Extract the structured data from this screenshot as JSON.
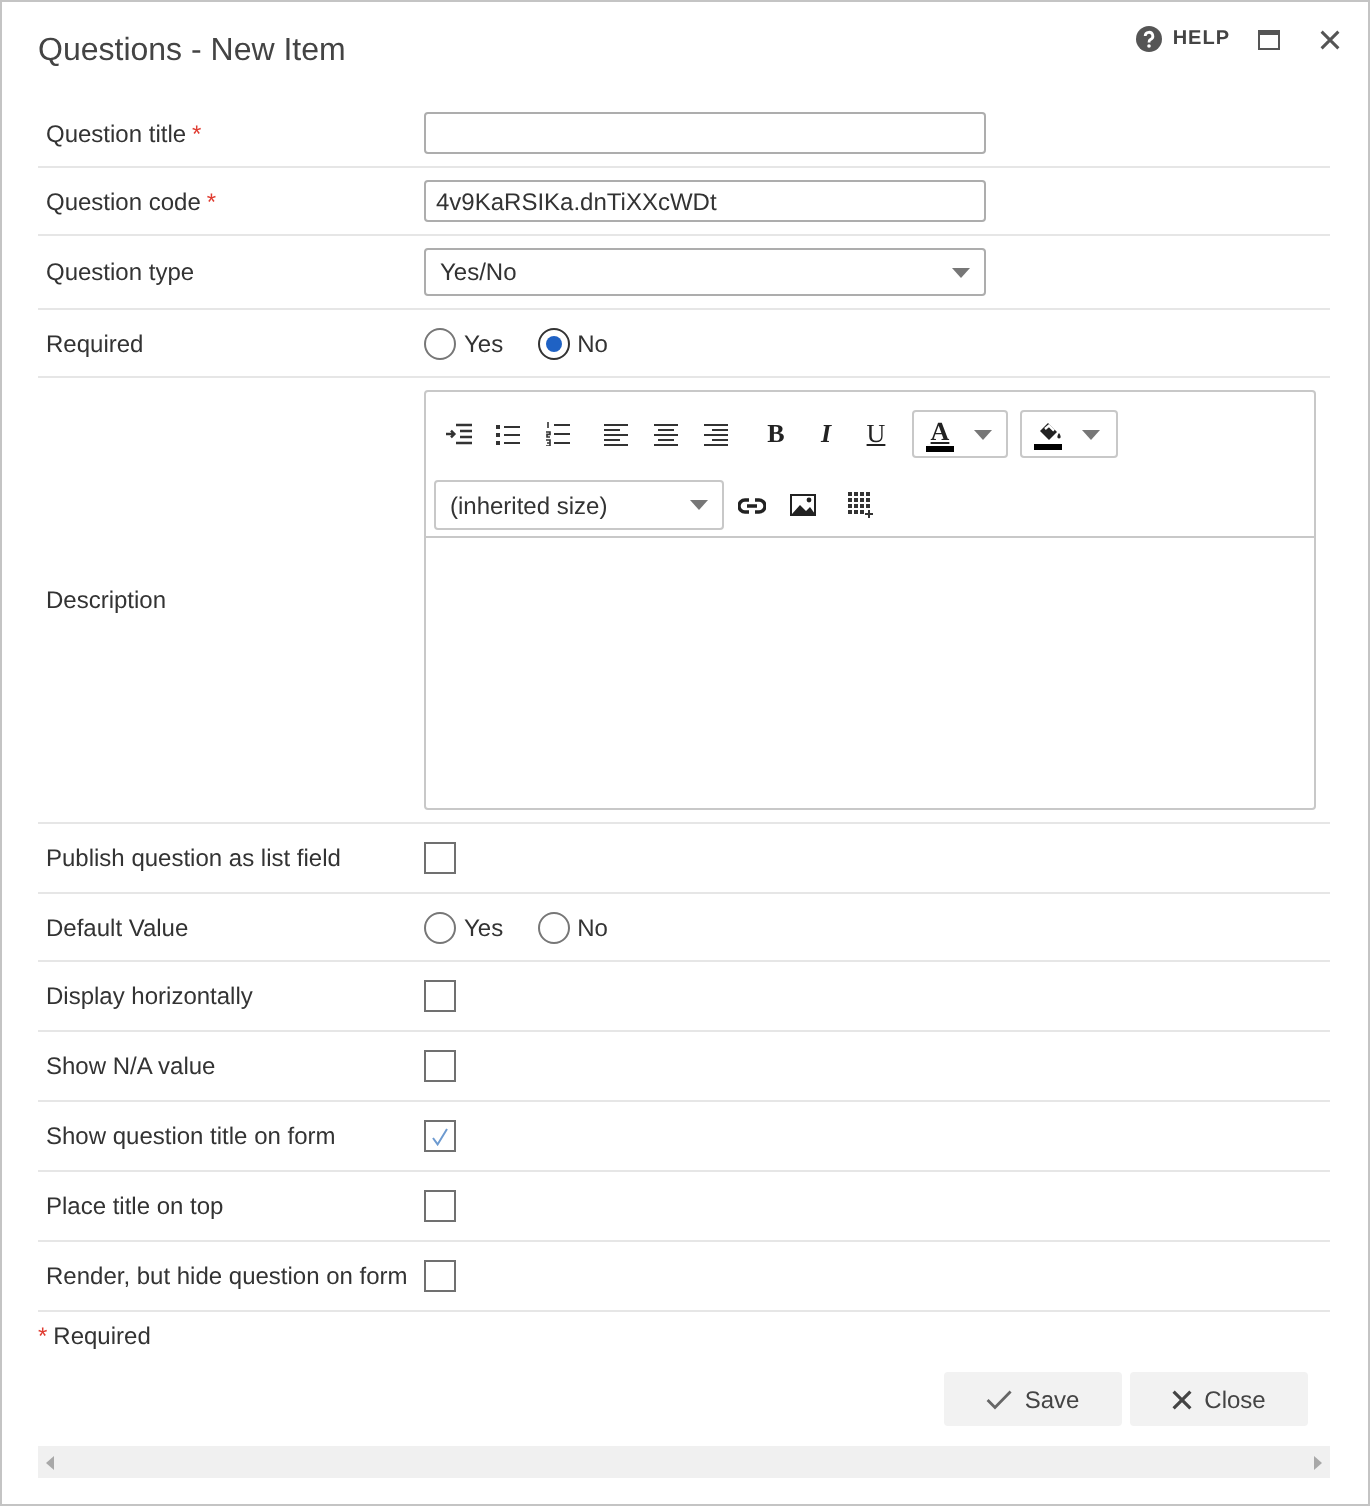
{
  "window": {
    "title": "Questions - New Item",
    "help_label": "HELP"
  },
  "fields": [
    {
      "kind": "text",
      "label": "Question title",
      "required_mark": "*"
    },
    {
      "kind": "text",
      "label": "Question code",
      "required_mark": "*",
      "value": "4v9KaRSIKa.dnTiXXcWDt"
    },
    {
      "kind": "select",
      "label": "Question type",
      "value": "Yes/No"
    },
    {
      "kind": "radio",
      "label": "Required",
      "options": [
        {
          "label": "Yes",
          "selected": false
        },
        {
          "label": "No",
          "selected": true
        }
      ]
    },
    {
      "kind": "editor",
      "label": "Description",
      "toolbar_rows": [
        [
          {
            "kind": "indent"
          },
          {
            "kind": "bullets"
          },
          {
            "kind": "numbering"
          },
          {
            "kind": "align_left"
          },
          {
            "kind": "align_center"
          },
          {
            "kind": "align_right"
          },
          {
            "kind": "bold",
            "label": "B"
          },
          {
            "kind": "italic",
            "label": "I"
          },
          {
            "kind": "underline",
            "label": "U"
          },
          {
            "kind": "font_color",
            "label": "A"
          },
          {
            "kind": "highlight"
          }
        ],
        [
          {
            "kind": "font_size",
            "value": "(inherited size)"
          },
          {
            "kind": "link"
          },
          {
            "kind": "image"
          },
          {
            "kind": "table"
          }
        ]
      ]
    },
    {
      "kind": "checkbox",
      "label": "Publish question as list field",
      "checked": false
    },
    {
      "kind": "radio",
      "label": "Default Value",
      "options": [
        {
          "label": "Yes",
          "selected": false
        },
        {
          "label": "No",
          "selected": false
        }
      ]
    },
    {
      "kind": "checkbox",
      "label": "Display horizontally",
      "checked": false
    },
    {
      "kind": "checkbox",
      "label": "Show N/A value",
      "checked": false
    },
    {
      "kind": "checkbox",
      "label": "Show question title on form",
      "checked": true
    },
    {
      "kind": "checkbox",
      "label": "Place title on top",
      "checked": false
    },
    {
      "kind": "checkbox",
      "label": "Render, but hide question on form",
      "checked": false
    }
  ],
  "required_note": {
    "mark": "*",
    "text": "Required"
  },
  "buttons": [
    {
      "kind": "save",
      "label": "Save"
    },
    {
      "kind": "close",
      "label": "Close"
    }
  ]
}
